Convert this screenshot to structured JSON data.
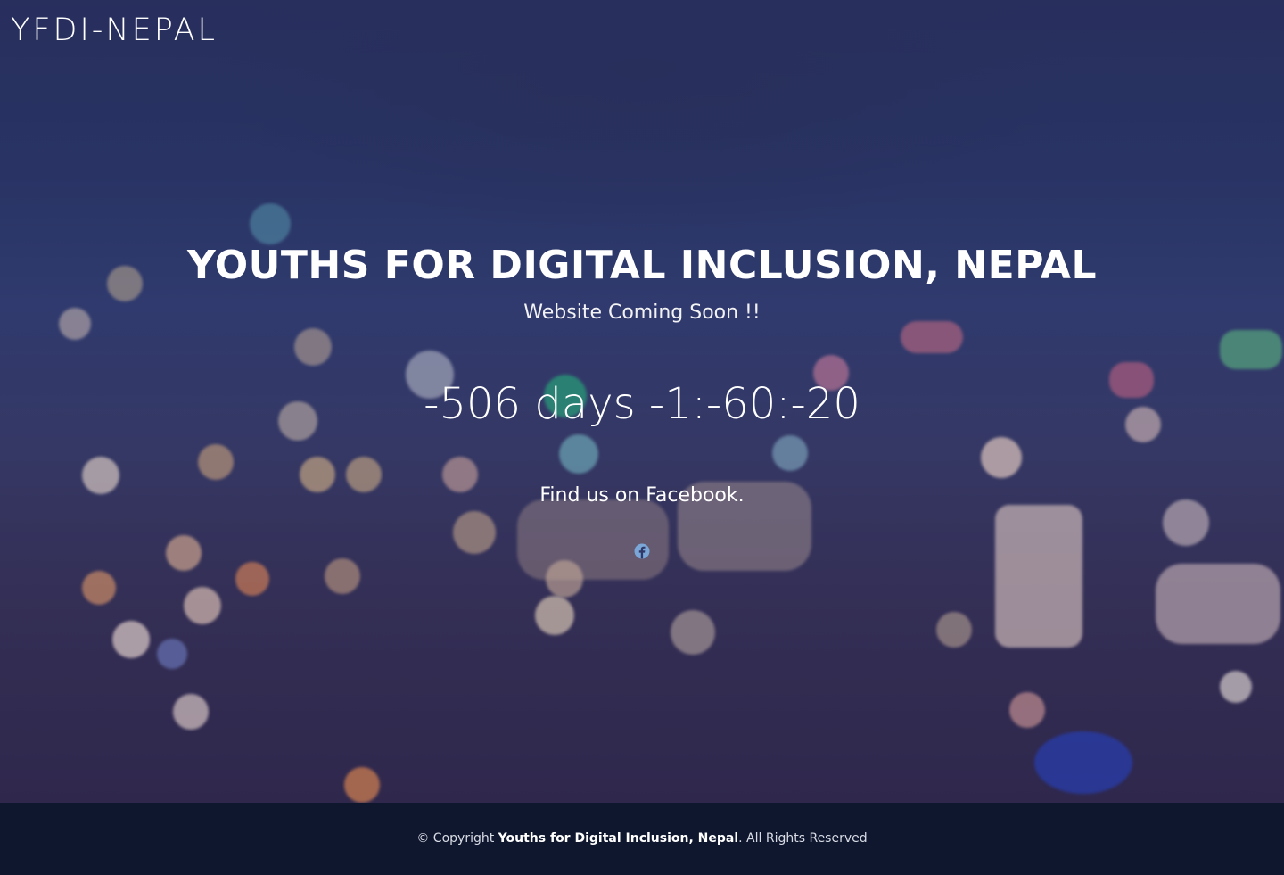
{
  "header": {
    "brand": "YFDI-NEPAL"
  },
  "hero": {
    "title": "YOUTHS FOR DIGITAL INCLUSION, NEPAL",
    "subtitle": "Website Coming Soon !!",
    "countdown": "-506 days -1:-60:-20",
    "social_text": "Find us on Facebook.",
    "social_icon": "facebook-icon"
  },
  "footer": {
    "prefix": "© Copyright ",
    "org": "Youths for Digital Inclusion, Nepal",
    "suffix": ". All Rights Reserved"
  },
  "colors": {
    "footer_bg": "#0f172e",
    "facebook_icon": "#7aa7d8",
    "text": "#ffffff"
  }
}
